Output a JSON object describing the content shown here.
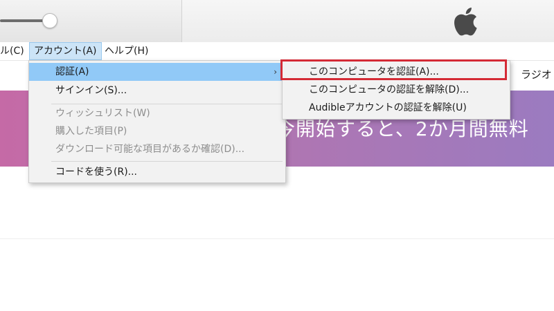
{
  "menubar": {
    "items": [
      {
        "label": "ル(C)"
      },
      {
        "label": "アカウント(A)"
      },
      {
        "label": "ヘルプ(H)"
      }
    ]
  },
  "account_menu": {
    "items": [
      {
        "label": "認証(A)",
        "highlighted": true,
        "submenu": true
      },
      {
        "label": "サインイン(S)...",
        "enabled": true
      },
      {
        "label": "ウィッシュリスト(W)",
        "enabled": false
      },
      {
        "label": "購入した項目(P)",
        "enabled": false
      },
      {
        "label": "ダウンロード可能な項目があるか確認(D)...",
        "enabled": false
      },
      {
        "label": "コードを使う(R)...",
        "enabled": true
      }
    ],
    "submenu_arrow": "›"
  },
  "auth_submenu": {
    "items": [
      {
        "label": "このコンピュータを認証(A)..."
      },
      {
        "label": "このコンピュータの認証を解除(D)..."
      },
      {
        "label": "Audibleアカウントの認証を解除(U)"
      }
    ]
  },
  "nav": {
    "radio": "ラジオ"
  },
  "banner": {
    "text": "今開始すると、2か月間無料"
  },
  "toolbar": {
    "volume_level": 0.85,
    "logo": "apple-icon"
  },
  "colors": {
    "highlight_box": "#d42a35",
    "menu_highlight": "#91c9f7",
    "banner_start": "#c56aa6",
    "banner_end": "#9b7bc0"
  }
}
